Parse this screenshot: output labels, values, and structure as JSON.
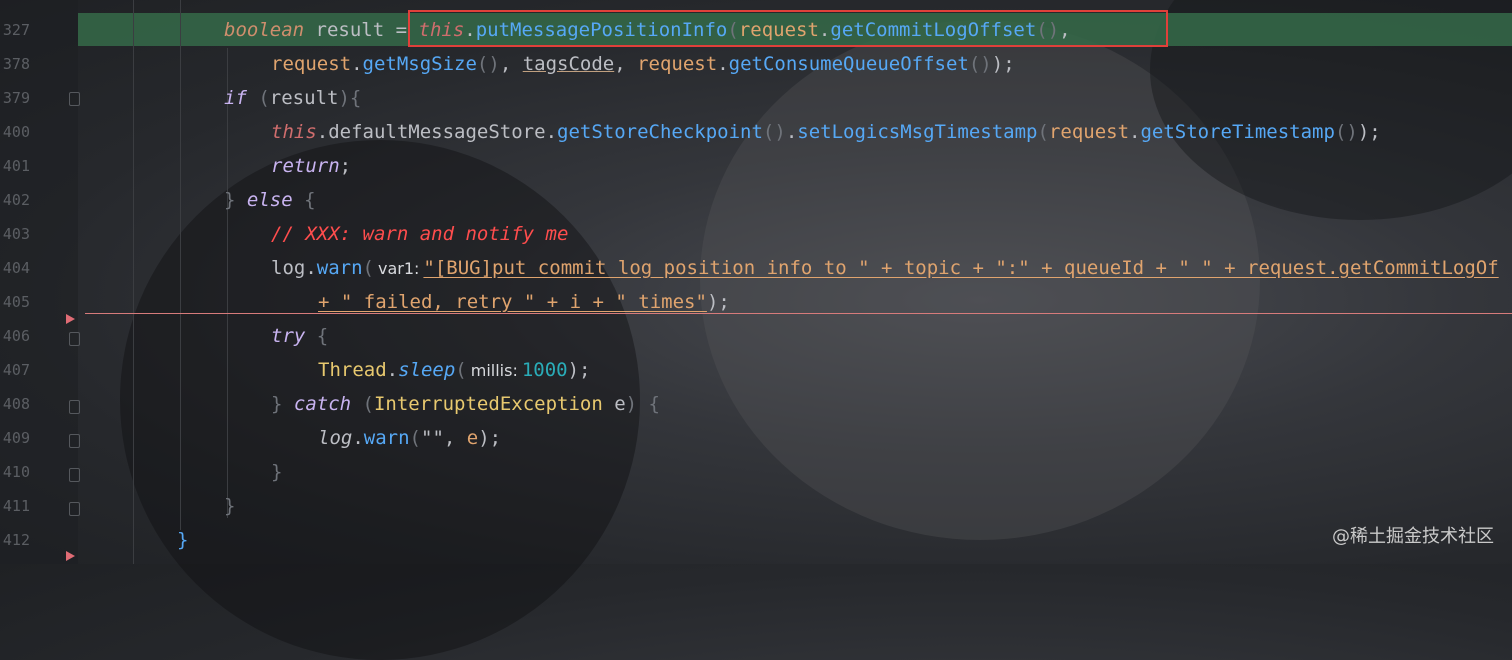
{
  "line_numbers": [
    "327",
    "378",
    "379",
    "400",
    "401",
    "402",
    "403",
    "404",
    "405",
    "406",
    "407",
    "408",
    "409",
    "410",
    "411",
    "412"
  ],
  "watermark": "@稀土掘金技术社区",
  "code": {
    "l1": {
      "type": "boolean",
      "var": " result ",
      "op": "=",
      "this": "this",
      "dot1": ".",
      "fn1": "putMessagePositionInfo",
      "p1": "(",
      "obj1": "request",
      ".": ".",
      "fn2": "getCommitLogOffset",
      "p2": "()",
      "comma": ","
    },
    "l2": {
      "obj": "request",
      "dot": ".",
      "fn": "getMsgSize",
      "p": "()",
      "c1": ", ",
      "tags": "tagsCode",
      "c2": ", ",
      "obj2": "request",
      "dot2": ".",
      "fn2": "getConsumeQueueOffset",
      "p2": "()",
      "end": ");"
    },
    "l3": {
      "kw": "if",
      "p1": "(",
      "var": "result",
      "p2": "){"
    },
    "l4": {
      "this": "this",
      "dot": ".",
      "field": "defaultMessageStore",
      "dot2": ".",
      "fn1": "getStoreCheckpoint",
      "p1": "()",
      "dot3": ".",
      "fn2": "setLogicsMsgTimestamp",
      "p2": "(",
      "obj": "request",
      "dot4": ".",
      "fn3": "getStoreTimestamp",
      "p3": "()",
      "end": ");"
    },
    "l5": {
      "kw": "return",
      "end": ";"
    },
    "l6": {
      "b1": "} ",
      "kw": "else",
      "b2": " {"
    },
    "l7": {
      "comment": "// XXX: warn and notify me"
    },
    "l8": {
      "obj": "log",
      "dot": ".",
      "fn": "warn",
      "p": "(",
      "hint": "var1:",
      "str": "\"[BUG]put commit log position info to \" + topic + \":\" + queueId + \" \" + request.getCommitLogOf"
    },
    "l9": {
      "str": "+ \" failed, retry \" + i + \" times\"",
      "end": ");"
    },
    "l10": {
      "kw": "try",
      "b": " {"
    },
    "l11": {
      "cls": "Thread",
      "dot": ".",
      "fn": "sleep",
      "p": "(",
      "hint": "millis:",
      "num": "1000",
      "end": ");"
    },
    "l12": {
      "b1": "} ",
      "kw": "catch",
      "p1": " (",
      "cls": "InterruptedException",
      "var": " e",
      "p2": ") {"
    },
    "l13": {
      "obj": "log",
      "dot": ".",
      "fn": "warn",
      "p1": "(",
      "str": "\"\"",
      "c": ", ",
      "var": "e",
      "end": ");"
    },
    "l14": {
      "b": "}"
    },
    "l15": {
      "b": "}"
    },
    "l16": {
      "b": "}"
    }
  }
}
